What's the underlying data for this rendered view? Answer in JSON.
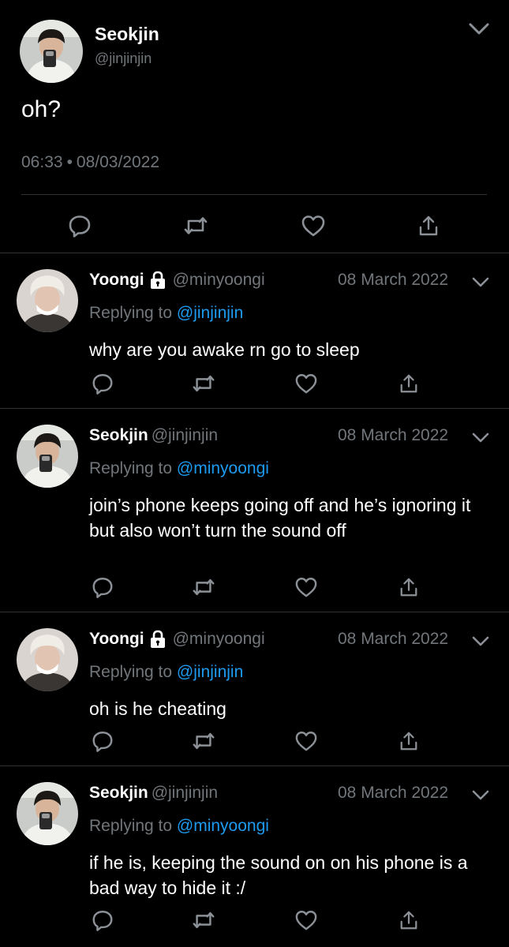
{
  "main_tweet": {
    "name": "Seokjin",
    "handle": "@jinjinjin",
    "text": "oh?",
    "time": "06:33",
    "separator": "•",
    "date": "08/03/2022"
  },
  "replies": [
    {
      "name": "Yoongi",
      "protected": true,
      "handle": "@minyoongi",
      "date": "08 March 2022",
      "replying_prefix": "Replying to",
      "replying_to": "@jinjinjin",
      "text": "why are you awake rn go to sleep"
    },
    {
      "name": "Seokjin",
      "protected": false,
      "handle": "@jinjinjin",
      "date": "08 March 2022",
      "replying_prefix": "Replying to",
      "replying_to": "@minyoongi",
      "text": "join’s phone keeps going off and he’s ignoring it but also won’t turn the sound off"
    },
    {
      "name": "Yoongi",
      "protected": true,
      "handle": "@minyoongi",
      "date": "08 March 2022",
      "replying_prefix": "Replying to",
      "replying_to": "@jinjinjin",
      "text": "oh is he cheating"
    },
    {
      "name": "Seokjin",
      "protected": false,
      "handle": "@jinjinjin",
      "date": "08 March 2022",
      "replying_prefix": "Replying to",
      "replying_to": "@minyoongi",
      "text": "if he is, keeping the sound on on his phone is a bad way to hide it :/"
    }
  ],
  "icons": {
    "reply": "reply-icon",
    "retweet": "retweet-icon",
    "like": "heart-icon",
    "share": "share-icon",
    "more": "chevron-down-icon",
    "lock": "lock-icon"
  },
  "colors": {
    "background": "#000000",
    "text": "#ffffff",
    "secondary": "#71767b",
    "link": "#1d9bf0",
    "divider": "#2f3336"
  }
}
